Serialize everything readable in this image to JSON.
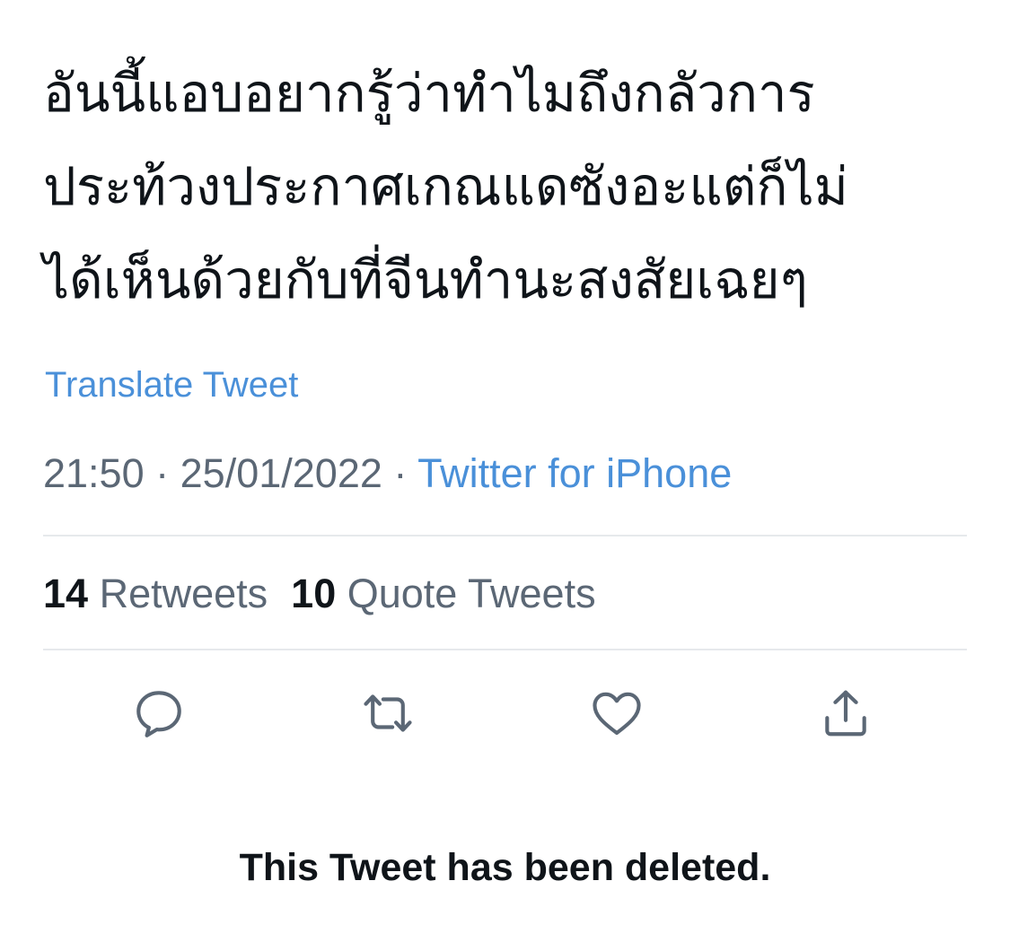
{
  "tweet": {
    "text_lines": [
      "อันนี้แอบอยากรู้ว่าทำไมถึงกลัวการ",
      "ประท้วงประกาศเกณแดซังอะแต่ก็ไม่",
      "ได้เห็นด้วยกับที่จีนทำนะสงสัยเฉยๆ"
    ],
    "translate_label": "Translate Tweet",
    "time": "21:50",
    "separator": "·",
    "date": "25/01/2022",
    "source": "Twitter for iPhone"
  },
  "stats": {
    "retweets_count": "14",
    "retweets_label": "Retweets",
    "quotes_count": "10",
    "quotes_label": "Quote Tweets"
  },
  "actions": {
    "icons": [
      "reply-icon",
      "retweet-icon",
      "like-icon",
      "share-icon"
    ],
    "icon_color": "#5b6775"
  },
  "deleted_notice": "This Tweet has been deleted.",
  "colors": {
    "link": "#4a90d9",
    "secondary_text": "#5b6775",
    "primary_text": "#0f1419",
    "divider": "#e6e9ec"
  }
}
